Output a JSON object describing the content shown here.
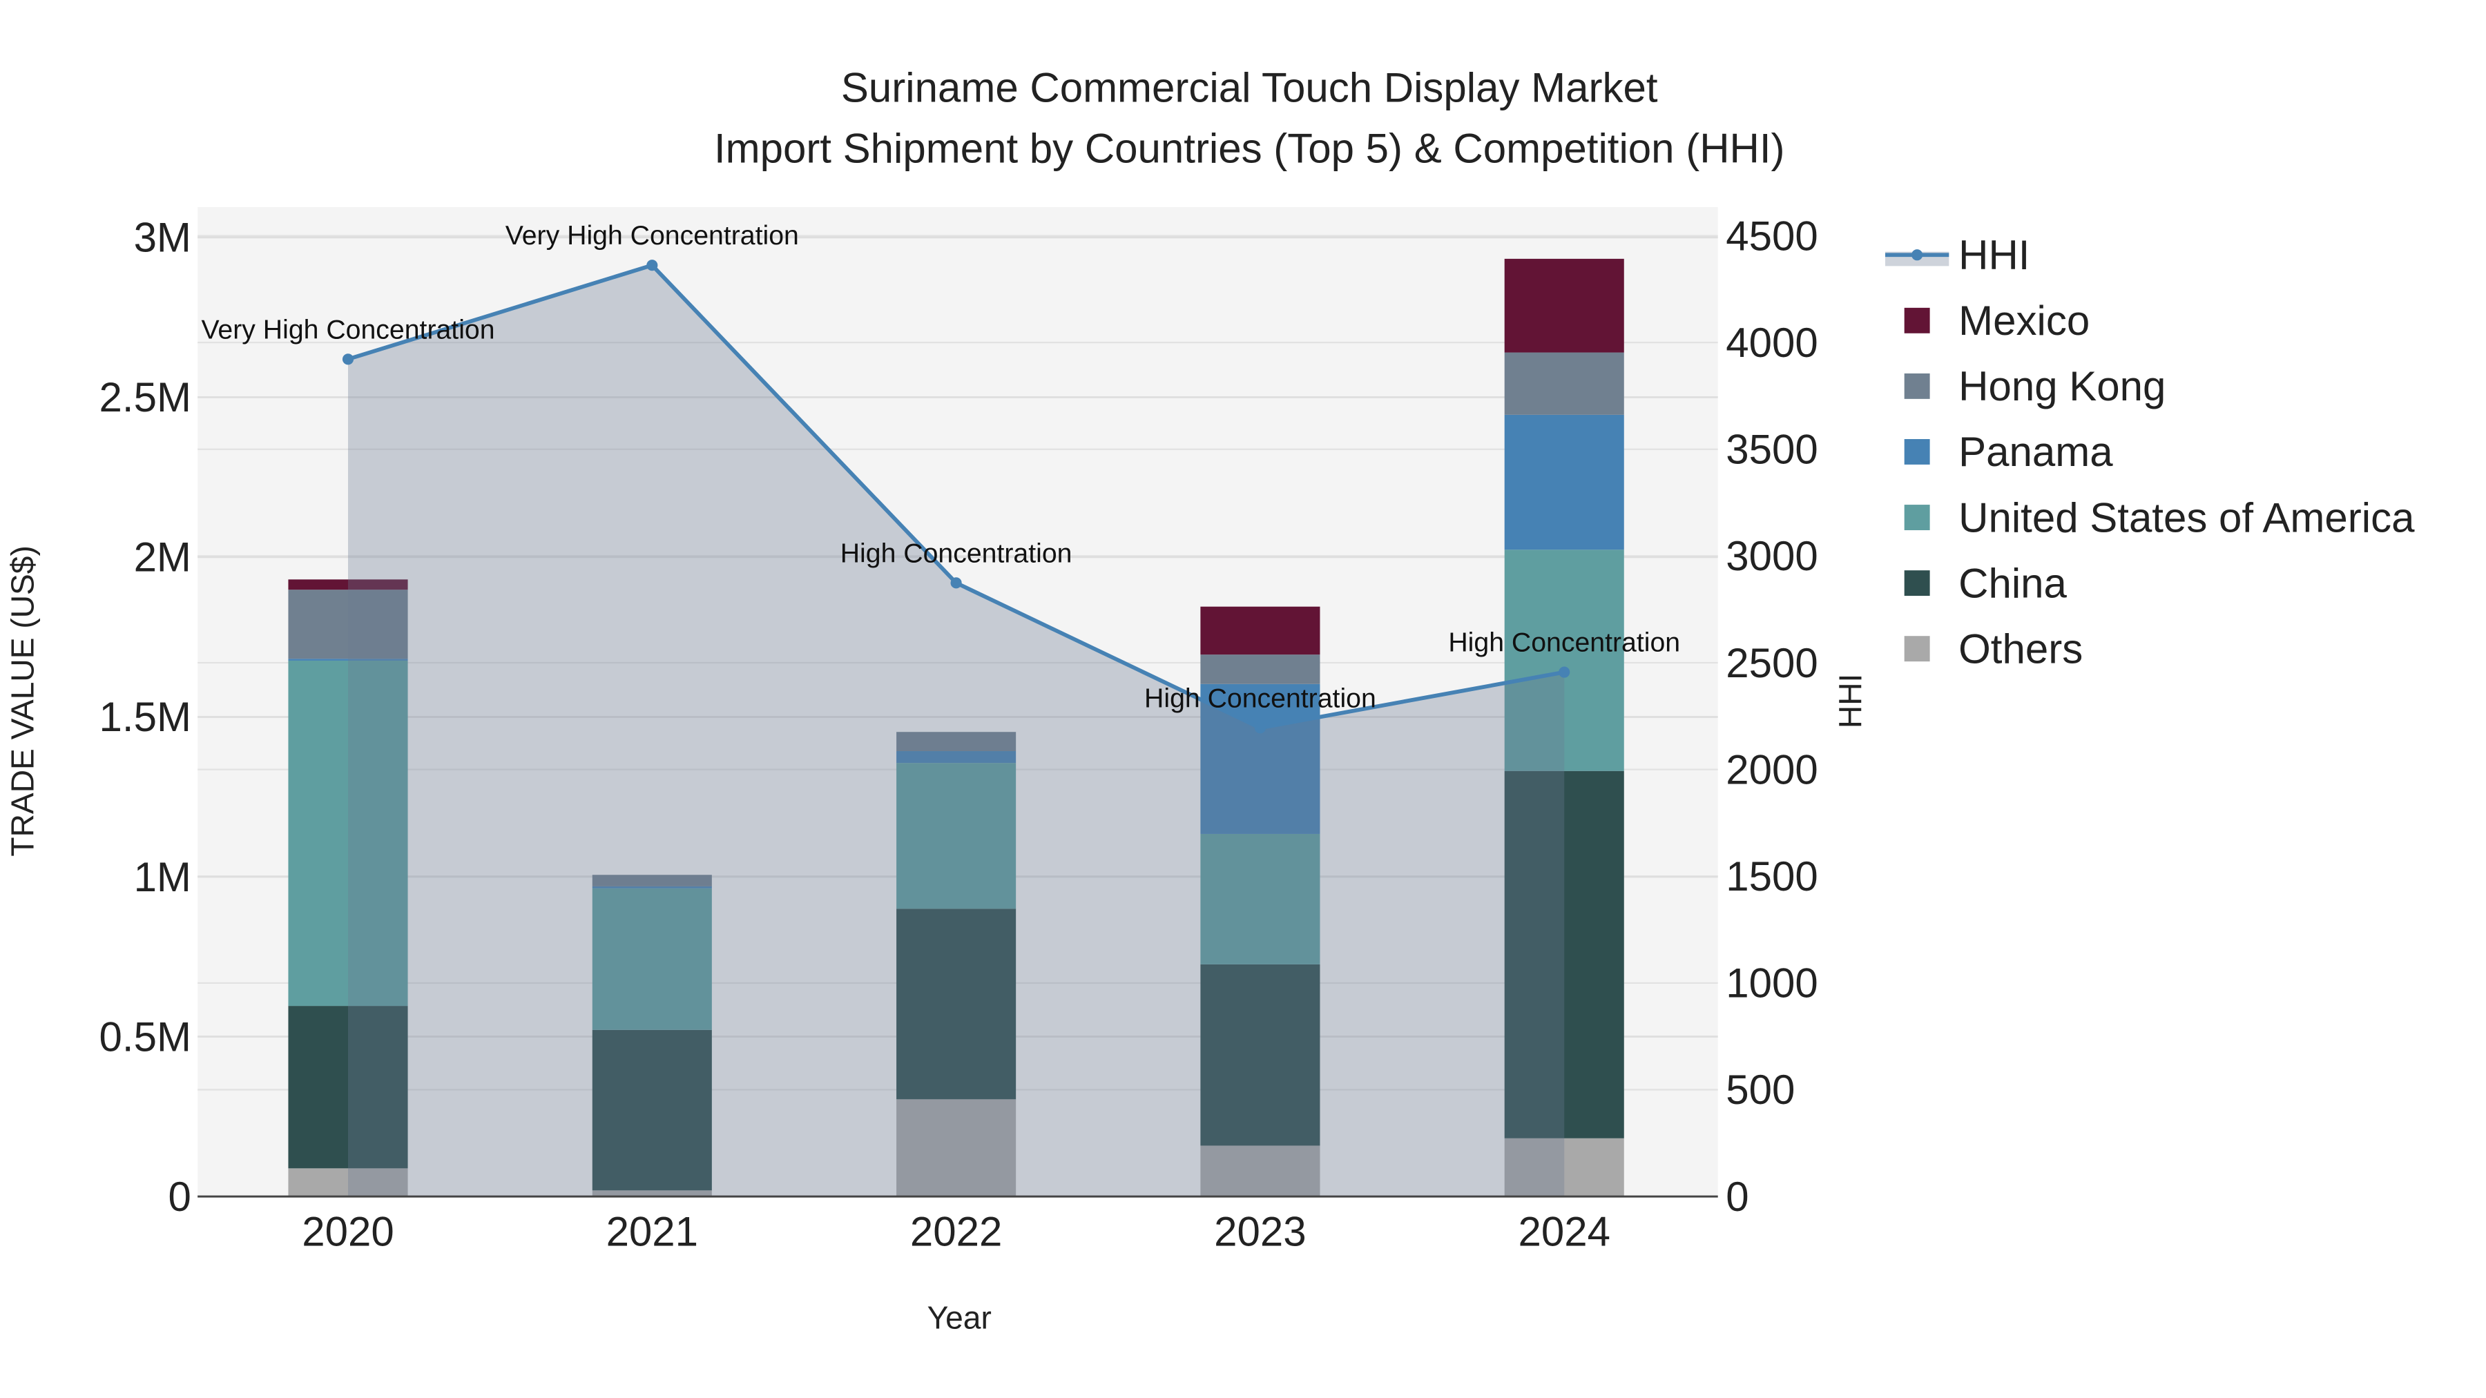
{
  "chart_data": {
    "type": "bar",
    "title": "Suriname Commercial Touch Display Market",
    "subtitle": "Import Shipment by Countries (Top 5) & Competition (HHI)",
    "xlabel": "Year",
    "ylabel": "TRADE VALUE (US$)",
    "y2label": "HHI",
    "categories": [
      "2020",
      "2021",
      "2022",
      "2023",
      "2024"
    ],
    "ylim": [
      0,
      3000000
    ],
    "y_ticks": [
      0,
      500000,
      1000000,
      1500000,
      2000000,
      2500000,
      3000000
    ],
    "y_tick_labels": [
      "0",
      "0.5M",
      "1M",
      "1.5M",
      "2M",
      "2.5M",
      "3M"
    ],
    "y2lim": [
      0,
      4500
    ],
    "y2_ticks": [
      0,
      500,
      1000,
      1500,
      2000,
      2500,
      3000,
      3500,
      4000,
      4500
    ],
    "y2_tick_labels": [
      "0",
      "500",
      "1000",
      "1500",
      "2000",
      "2500",
      "3000",
      "3500",
      "4000",
      "4500"
    ],
    "grid": true,
    "legend_position": "right",
    "series": [
      {
        "name": "Others",
        "color": "#A9A9A9",
        "values": [
          88000,
          19000,
          304000,
          159000,
          182000
        ]
      },
      {
        "name": "China",
        "color": "#2F4F4F",
        "values": [
          508000,
          502000,
          596000,
          567000,
          1149000
        ]
      },
      {
        "name": "United States of America",
        "color": "#5F9EA0",
        "values": [
          1080000,
          443000,
          456000,
          408000,
          692000
        ]
      },
      {
        "name": "Panama",
        "color": "#4682B4",
        "values": [
          6000,
          6000,
          37000,
          469000,
          422000
        ]
      },
      {
        "name": "Hong Kong",
        "color": "#708090",
        "values": [
          216000,
          36000,
          60000,
          92000,
          195000
        ]
      },
      {
        "name": "Mexico",
        "color": "#621435",
        "values": [
          32000,
          0,
          0,
          150000,
          293000
        ]
      }
    ],
    "hhi": {
      "name": "HHI",
      "color": "#4682B4",
      "values": [
        3922,
        4362,
        2874,
        2195,
        2456
      ],
      "annotations": [
        "Very High Concentration",
        "Very High Concentration",
        "High Concentration",
        "High Concentration",
        "High Concentration"
      ]
    },
    "legend_order": [
      "HHI",
      "Mexico",
      "Hong Kong",
      "Panama",
      "United States of America",
      "China",
      "Others"
    ]
  }
}
